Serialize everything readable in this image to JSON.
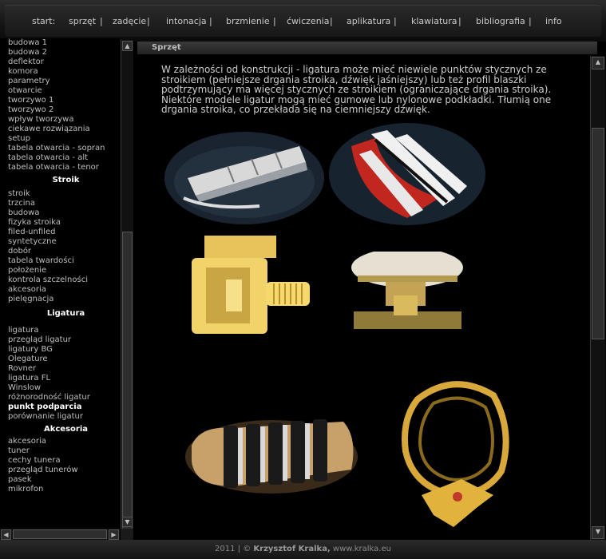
{
  "nav": [
    "start:",
    "sprzęt",
    "zadęcie",
    "intonacja",
    "brzmienie",
    "ćwiczenia",
    "aplikatura",
    "klawiatura",
    "bibliografia",
    "info"
  ],
  "nav_sep": "|",
  "sidebar": {
    "group_top": [
      "budowa 1",
      "budowa 2",
      "deflektor",
      "komora",
      "parametry",
      "otwarcie",
      "tworzywo 1",
      "tworzywo 2",
      "wpływ tworzywa",
      "ciekawe rozwiązania",
      "setup",
      "tabela otwarcia - sopran",
      "tabela otwarcia - alt",
      "tabela otwarcia - tenor"
    ],
    "head_stroik": "Stroik",
    "group_stroik": [
      "stroik",
      "trzcina",
      "budowa",
      "fizyka stroika",
      "filed-unfiled",
      "syntetyczne",
      "dobór",
      "tabela twardości",
      "położenie",
      "kontrola szczelności",
      "akcesoria",
      "pielęgnacja"
    ],
    "head_ligatura": "Ligatura",
    "group_ligatura": [
      "ligatura",
      "przegląd ligatur",
      "ligatury BG",
      "Olegature",
      "Rovner",
      "ligatura FL",
      "Winslow",
      "różnorodność ligatur",
      "punkt podparcia",
      "porównanie ligatur"
    ],
    "head_akcesoria": "Akcesoria",
    "group_akcesoria": [
      "akcesoria",
      "tuner",
      "cechy tunera",
      "przegląd tunerów",
      "pasek",
      "mikrofon"
    ]
  },
  "content_title": "Sprzęt",
  "paragraph": "W zależności od konstrukcji - ligatura może mieć niewiele punktów stycznych ze stroikiem (pełniejsze drgania stroika, dźwięk jaśniejszy) lub też profil blaszki podtrzymujący ma więcej stycznych ze stroikiem (ograniczające drgania stroika). Niektóre modele ligatur mogą mieć gumowe lub nylonowe podkładki. Tłumią one drgania stroika, co przekłada się na ciemniejszy dźwięk.",
  "footer": {
    "year": "2011 | ©",
    "author": "Krzysztof Kralka,",
    "site": "www.kralka.eu"
  },
  "scroll_up": "▲",
  "scroll_down": "▼",
  "scroll_left": "◀",
  "scroll_right": "▶"
}
